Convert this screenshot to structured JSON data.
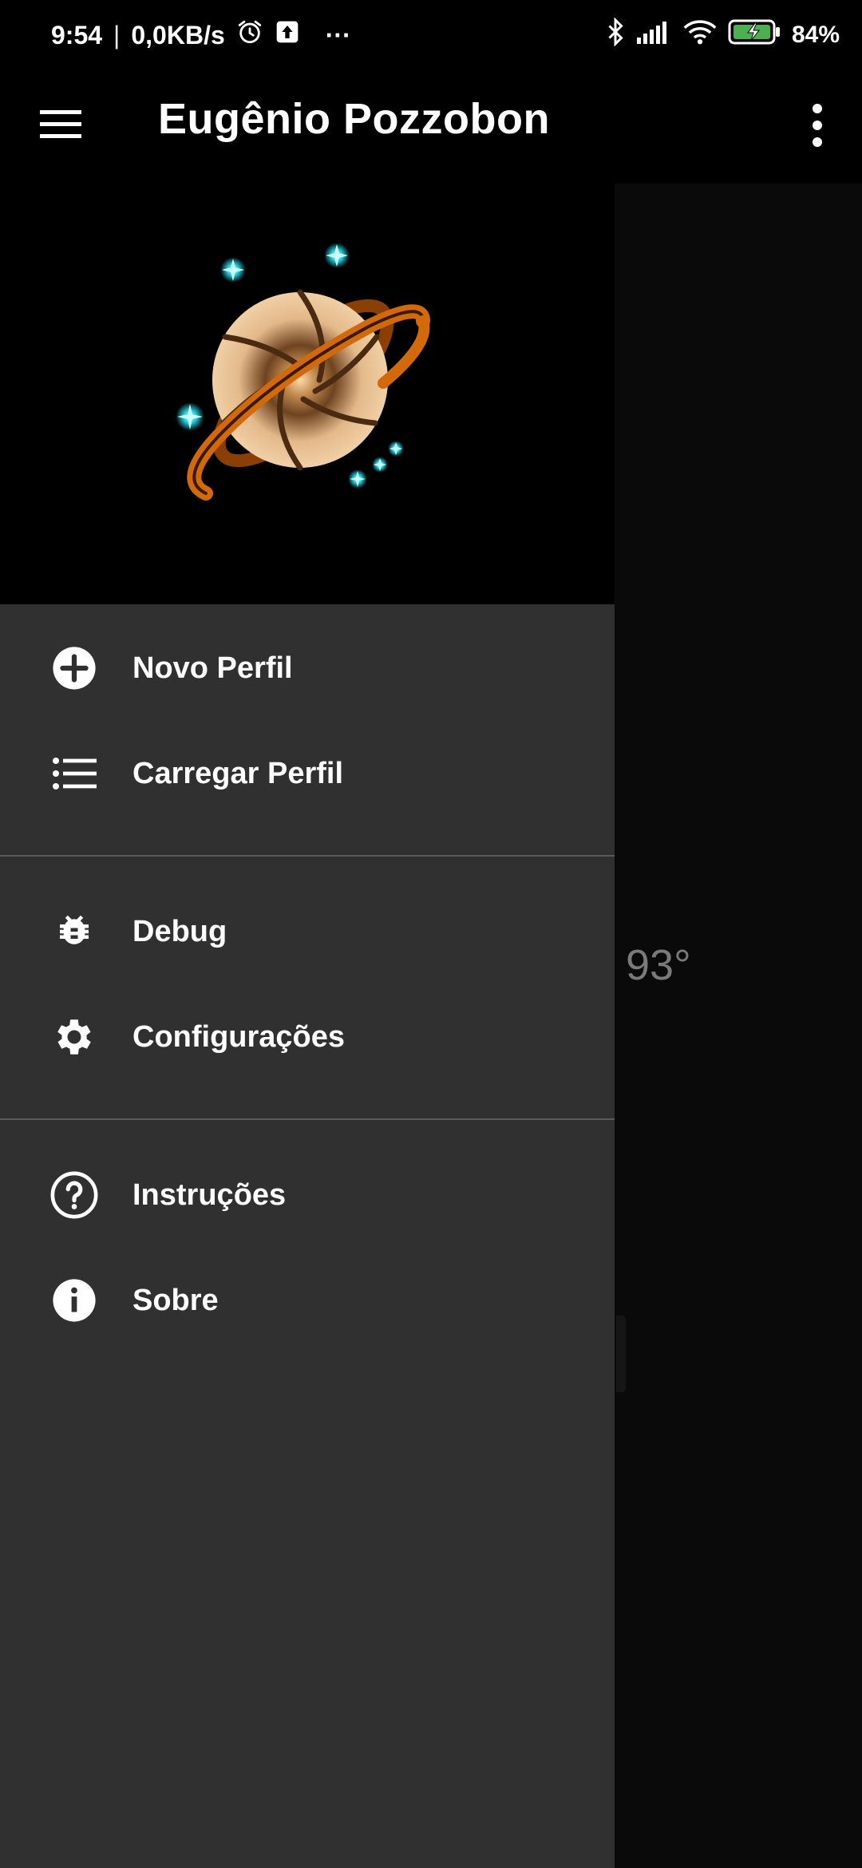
{
  "status_bar": {
    "time": "9:54",
    "separator": "|",
    "net_speed": "0,0KB/s",
    "more": "···",
    "battery": "84%",
    "icons": [
      "alarm-icon",
      "upload-icon",
      "bluetooth-icon",
      "signal-icon",
      "wifi-icon",
      "battery-charging-icon"
    ]
  },
  "app_bar": {
    "title": "Eugênio Pozzobon",
    "menu_icon": "hamburger-icon",
    "overflow_icon": "more-vert-icon"
  },
  "drawer": {
    "header_logo": "saturn-aperture-logo",
    "groups": [
      [
        {
          "label": "Novo Perfil",
          "icon": "add-circle-icon"
        },
        {
          "label": "Carregar Perfil",
          "icon": "list-icon"
        }
      ],
      [
        {
          "label": "Debug",
          "icon": "bug-icon"
        },
        {
          "label": "Configurações",
          "icon": "gear-icon"
        }
      ],
      [
        {
          "label": "Instruções",
          "icon": "help-circle-icon"
        },
        {
          "label": "Sobre",
          "icon": "info-icon"
        }
      ]
    ]
  },
  "background": {
    "value": "93°",
    "fragment": ":"
  },
  "colors": {
    "drawer_bg": "#303030",
    "header_bg": "#000000",
    "battery_green": "#4caf50",
    "accent_star": "#23c8d8",
    "ring_orange": "#d2690a"
  }
}
